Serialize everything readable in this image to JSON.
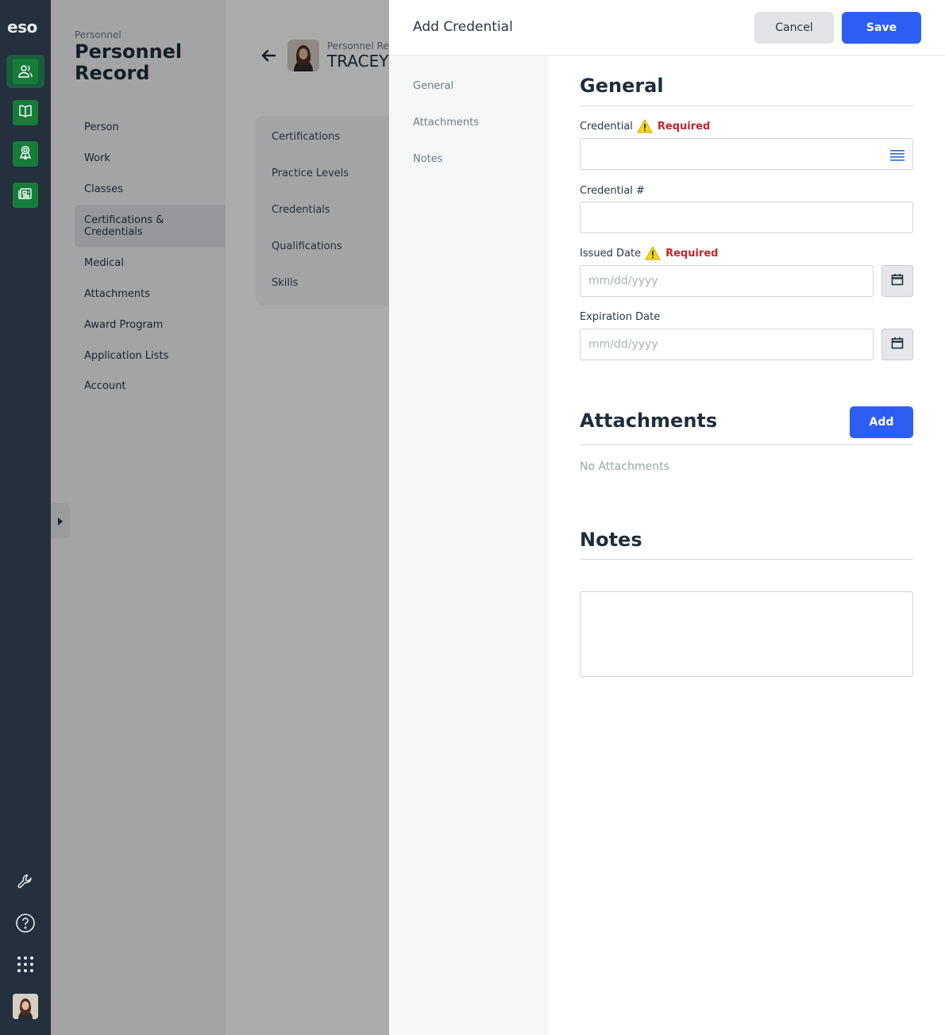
{
  "app": {
    "logo": "eso"
  },
  "rail": {
    "nav_icons": [
      "people-icon",
      "book-icon",
      "award-icon",
      "news-icon"
    ],
    "util_icons": [
      "wrench-icon",
      "help-icon",
      "apps-grid-icon"
    ]
  },
  "page": {
    "breadcrumb": "Personnel",
    "title": "Personnel Record",
    "subnav": [
      "Person",
      "Work",
      "Classes",
      "Certifications & Credentials",
      "Medical",
      "Attachments",
      "Award Program",
      "Application Lists",
      "Account"
    ],
    "selected_subnav": "Certifications & Credentials",
    "person_label": "Personnel Re",
    "person_name": "TRACEY",
    "cert_tabs": [
      "Certifications",
      "Practice Levels",
      "Credentials",
      "Qualifications",
      "Skills"
    ]
  },
  "drawer": {
    "title": "Add Credential",
    "cancel_label": "Cancel",
    "save_label": "Save",
    "nav": [
      "General",
      "Attachments",
      "Notes"
    ],
    "general": {
      "heading": "General",
      "credential_label": "Credential",
      "credential_required": "Required",
      "credential_number_label": "Credential #",
      "issued_date_label": "Issued Date",
      "issued_date_required": "Required",
      "issued_date_placeholder": "mm/dd/yyyy",
      "expiration_date_label": "Expiration Date",
      "expiration_date_placeholder": "mm/dd/yyyy"
    },
    "attachments": {
      "heading": "Attachments",
      "add_label": "Add",
      "empty_text": "No Attachments"
    },
    "notes": {
      "heading": "Notes"
    }
  },
  "colors": {
    "rail_bg": "#24303d",
    "rail_icon_bg": "#157c3a",
    "primary": "#2d5ef2",
    "required": "#c0262d",
    "warning": "#f5d90a"
  }
}
